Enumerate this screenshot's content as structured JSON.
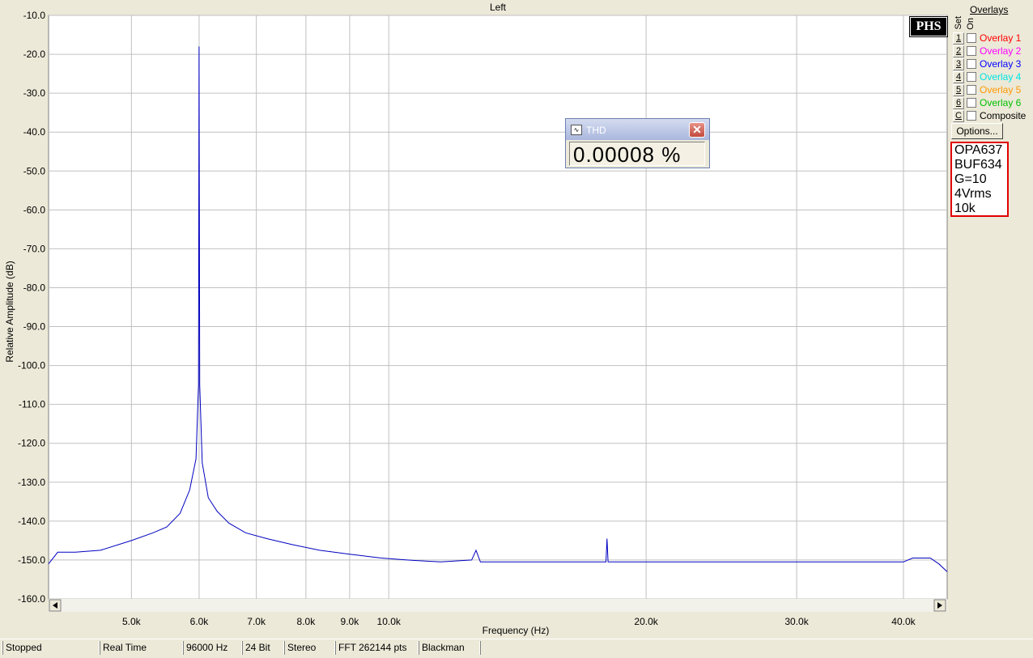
{
  "window": {
    "channel_title": "Left"
  },
  "chart_data": {
    "type": "line",
    "title": "Left",
    "xlabel": "Frequency (Hz)",
    "ylabel": "Relative Amplitude (dB)",
    "x_scale": "log",
    "xlim": [
      4000,
      45000
    ],
    "ylim": [
      -160,
      -10
    ],
    "x_tick_values": [
      5000,
      6000,
      7000,
      8000,
      9000,
      10000,
      20000,
      30000,
      40000
    ],
    "x_tick_labels": [
      "5.0k",
      "6.0k",
      "7.0k",
      "8.0k",
      "9.0k",
      "10.0k",
      "20.0k",
      "30.0k",
      "40.0k"
    ],
    "y_tick_values": [
      -10,
      -20,
      -30,
      -40,
      -50,
      -60,
      -70,
      -80,
      -90,
      -100,
      -110,
      -120,
      -130,
      -140,
      -150,
      -160
    ],
    "y_tick_labels": [
      "-10.0",
      "-20.0",
      "-30.0",
      "-40.0",
      "-50.0",
      "-60.0",
      "-70.0",
      "-80.0",
      "-90.0",
      "-100.0",
      "-110.0",
      "-120.0",
      "-130.0",
      "-140.0",
      "-150.0",
      "-160.0"
    ],
    "grid": true,
    "series": [
      {
        "color": "#0000c0",
        "x": [
          4000,
          4100,
          4300,
          4600,
          5000,
          5300,
          5500,
          5700,
          5850,
          5950,
          5990,
          6000,
          6010,
          6050,
          6150,
          6300,
          6500,
          6800,
          7200,
          7700,
          8300,
          9000,
          9800,
          10500,
          11500,
          12500,
          12650,
          12800,
          14000,
          16000,
          17950,
          18000,
          18050,
          20000,
          25000,
          30000,
          35000,
          40000,
          41000,
          43000,
          44000,
          45000
        ],
        "y": [
          -151,
          -148,
          -148,
          -147.5,
          -145,
          -143,
          -141.5,
          -138,
          -132,
          -124,
          -105,
          -18,
          -105,
          -125,
          -134,
          -137.5,
          -140.5,
          -143,
          -144.5,
          -146,
          -147.5,
          -148.5,
          -149.5,
          -150,
          -150.5,
          -150,
          -147.5,
          -150.5,
          -150.5,
          -150.5,
          -150.5,
          -144.5,
          -150.5,
          -150.5,
          -150.5,
          -150.5,
          -150.5,
          -150.5,
          -149.5,
          -149.5,
          -151,
          -153
        ]
      }
    ]
  },
  "overlays": {
    "title": "Overlays",
    "hdr_set": "Set",
    "hdr_on": "On",
    "items": [
      {
        "key": "1",
        "label": "Overlay 1",
        "color": "#ff0000",
        "checked": false
      },
      {
        "key": "2",
        "label": "Overlay 2",
        "color": "#ff00ff",
        "checked": false
      },
      {
        "key": "3",
        "label": "Overlay 3",
        "color": "#0000ff",
        "checked": false
      },
      {
        "key": "4",
        "label": "Overlay 4",
        "color": "#00e5e5",
        "checked": false
      },
      {
        "key": "5",
        "label": "Overlay 5",
        "color": "#ff9900",
        "checked": false
      },
      {
        "key": "6",
        "label": "Overlay 6",
        "color": "#00c000",
        "checked": false
      },
      {
        "key": "C",
        "label": "Composite",
        "color": "#000000",
        "checked": false
      }
    ],
    "options_label": "Options...",
    "logo_text": "PHS"
  },
  "info_box": {
    "lines": [
      "OPA637",
      "BUF634",
      "G=10",
      "4Vrms",
      "10k"
    ]
  },
  "thd": {
    "title": "THD",
    "value": "0.00008 %"
  },
  "status_bar": [
    "Stopped",
    "Real Time",
    "96000 Hz",
    "24 Bit",
    "Stereo",
    "FFT 262144 pts",
    "Blackman"
  ]
}
